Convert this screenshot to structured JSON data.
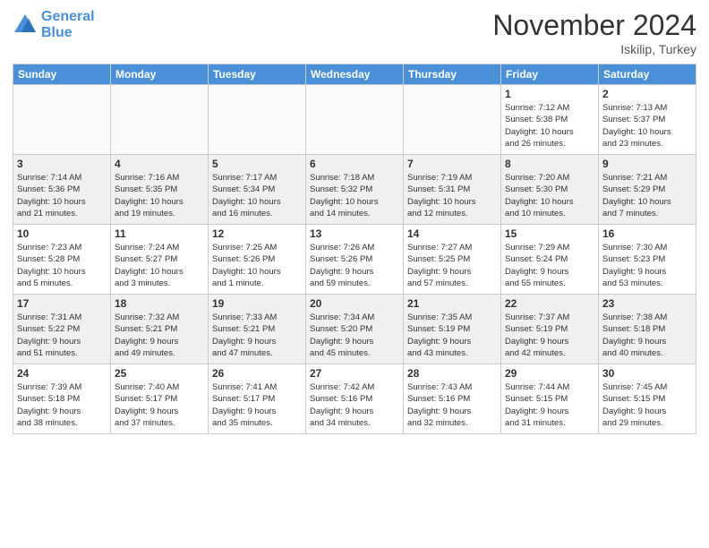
{
  "logo": {
    "line1": "General",
    "line2": "Blue"
  },
  "title": "November 2024",
  "location": "Iskilip, Turkey",
  "days_header": [
    "Sunday",
    "Monday",
    "Tuesday",
    "Wednesday",
    "Thursday",
    "Friday",
    "Saturday"
  ],
  "weeks": [
    [
      {
        "day": "",
        "info": ""
      },
      {
        "day": "",
        "info": ""
      },
      {
        "day": "",
        "info": ""
      },
      {
        "day": "",
        "info": ""
      },
      {
        "day": "",
        "info": ""
      },
      {
        "day": "1",
        "info": "Sunrise: 7:12 AM\nSunset: 5:38 PM\nDaylight: 10 hours\nand 26 minutes."
      },
      {
        "day": "2",
        "info": "Sunrise: 7:13 AM\nSunset: 5:37 PM\nDaylight: 10 hours\nand 23 minutes."
      }
    ],
    [
      {
        "day": "3",
        "info": "Sunrise: 7:14 AM\nSunset: 5:36 PM\nDaylight: 10 hours\nand 21 minutes."
      },
      {
        "day": "4",
        "info": "Sunrise: 7:16 AM\nSunset: 5:35 PM\nDaylight: 10 hours\nand 19 minutes."
      },
      {
        "day": "5",
        "info": "Sunrise: 7:17 AM\nSunset: 5:34 PM\nDaylight: 10 hours\nand 16 minutes."
      },
      {
        "day": "6",
        "info": "Sunrise: 7:18 AM\nSunset: 5:32 PM\nDaylight: 10 hours\nand 14 minutes."
      },
      {
        "day": "7",
        "info": "Sunrise: 7:19 AM\nSunset: 5:31 PM\nDaylight: 10 hours\nand 12 minutes."
      },
      {
        "day": "8",
        "info": "Sunrise: 7:20 AM\nSunset: 5:30 PM\nDaylight: 10 hours\nand 10 minutes."
      },
      {
        "day": "9",
        "info": "Sunrise: 7:21 AM\nSunset: 5:29 PM\nDaylight: 10 hours\nand 7 minutes."
      }
    ],
    [
      {
        "day": "10",
        "info": "Sunrise: 7:23 AM\nSunset: 5:28 PM\nDaylight: 10 hours\nand 5 minutes."
      },
      {
        "day": "11",
        "info": "Sunrise: 7:24 AM\nSunset: 5:27 PM\nDaylight: 10 hours\nand 3 minutes."
      },
      {
        "day": "12",
        "info": "Sunrise: 7:25 AM\nSunset: 5:26 PM\nDaylight: 10 hours\nand 1 minute."
      },
      {
        "day": "13",
        "info": "Sunrise: 7:26 AM\nSunset: 5:26 PM\nDaylight: 9 hours\nand 59 minutes."
      },
      {
        "day": "14",
        "info": "Sunrise: 7:27 AM\nSunset: 5:25 PM\nDaylight: 9 hours\nand 57 minutes."
      },
      {
        "day": "15",
        "info": "Sunrise: 7:29 AM\nSunset: 5:24 PM\nDaylight: 9 hours\nand 55 minutes."
      },
      {
        "day": "16",
        "info": "Sunrise: 7:30 AM\nSunset: 5:23 PM\nDaylight: 9 hours\nand 53 minutes."
      }
    ],
    [
      {
        "day": "17",
        "info": "Sunrise: 7:31 AM\nSunset: 5:22 PM\nDaylight: 9 hours\nand 51 minutes."
      },
      {
        "day": "18",
        "info": "Sunrise: 7:32 AM\nSunset: 5:21 PM\nDaylight: 9 hours\nand 49 minutes."
      },
      {
        "day": "19",
        "info": "Sunrise: 7:33 AM\nSunset: 5:21 PM\nDaylight: 9 hours\nand 47 minutes."
      },
      {
        "day": "20",
        "info": "Sunrise: 7:34 AM\nSunset: 5:20 PM\nDaylight: 9 hours\nand 45 minutes."
      },
      {
        "day": "21",
        "info": "Sunrise: 7:35 AM\nSunset: 5:19 PM\nDaylight: 9 hours\nand 43 minutes."
      },
      {
        "day": "22",
        "info": "Sunrise: 7:37 AM\nSunset: 5:19 PM\nDaylight: 9 hours\nand 42 minutes."
      },
      {
        "day": "23",
        "info": "Sunrise: 7:38 AM\nSunset: 5:18 PM\nDaylight: 9 hours\nand 40 minutes."
      }
    ],
    [
      {
        "day": "24",
        "info": "Sunrise: 7:39 AM\nSunset: 5:18 PM\nDaylight: 9 hours\nand 38 minutes."
      },
      {
        "day": "25",
        "info": "Sunrise: 7:40 AM\nSunset: 5:17 PM\nDaylight: 9 hours\nand 37 minutes."
      },
      {
        "day": "26",
        "info": "Sunrise: 7:41 AM\nSunset: 5:17 PM\nDaylight: 9 hours\nand 35 minutes."
      },
      {
        "day": "27",
        "info": "Sunrise: 7:42 AM\nSunset: 5:16 PM\nDaylight: 9 hours\nand 34 minutes."
      },
      {
        "day": "28",
        "info": "Sunrise: 7:43 AM\nSunset: 5:16 PM\nDaylight: 9 hours\nand 32 minutes."
      },
      {
        "day": "29",
        "info": "Sunrise: 7:44 AM\nSunset: 5:15 PM\nDaylight: 9 hours\nand 31 minutes."
      },
      {
        "day": "30",
        "info": "Sunrise: 7:45 AM\nSunset: 5:15 PM\nDaylight: 9 hours\nand 29 minutes."
      }
    ]
  ]
}
